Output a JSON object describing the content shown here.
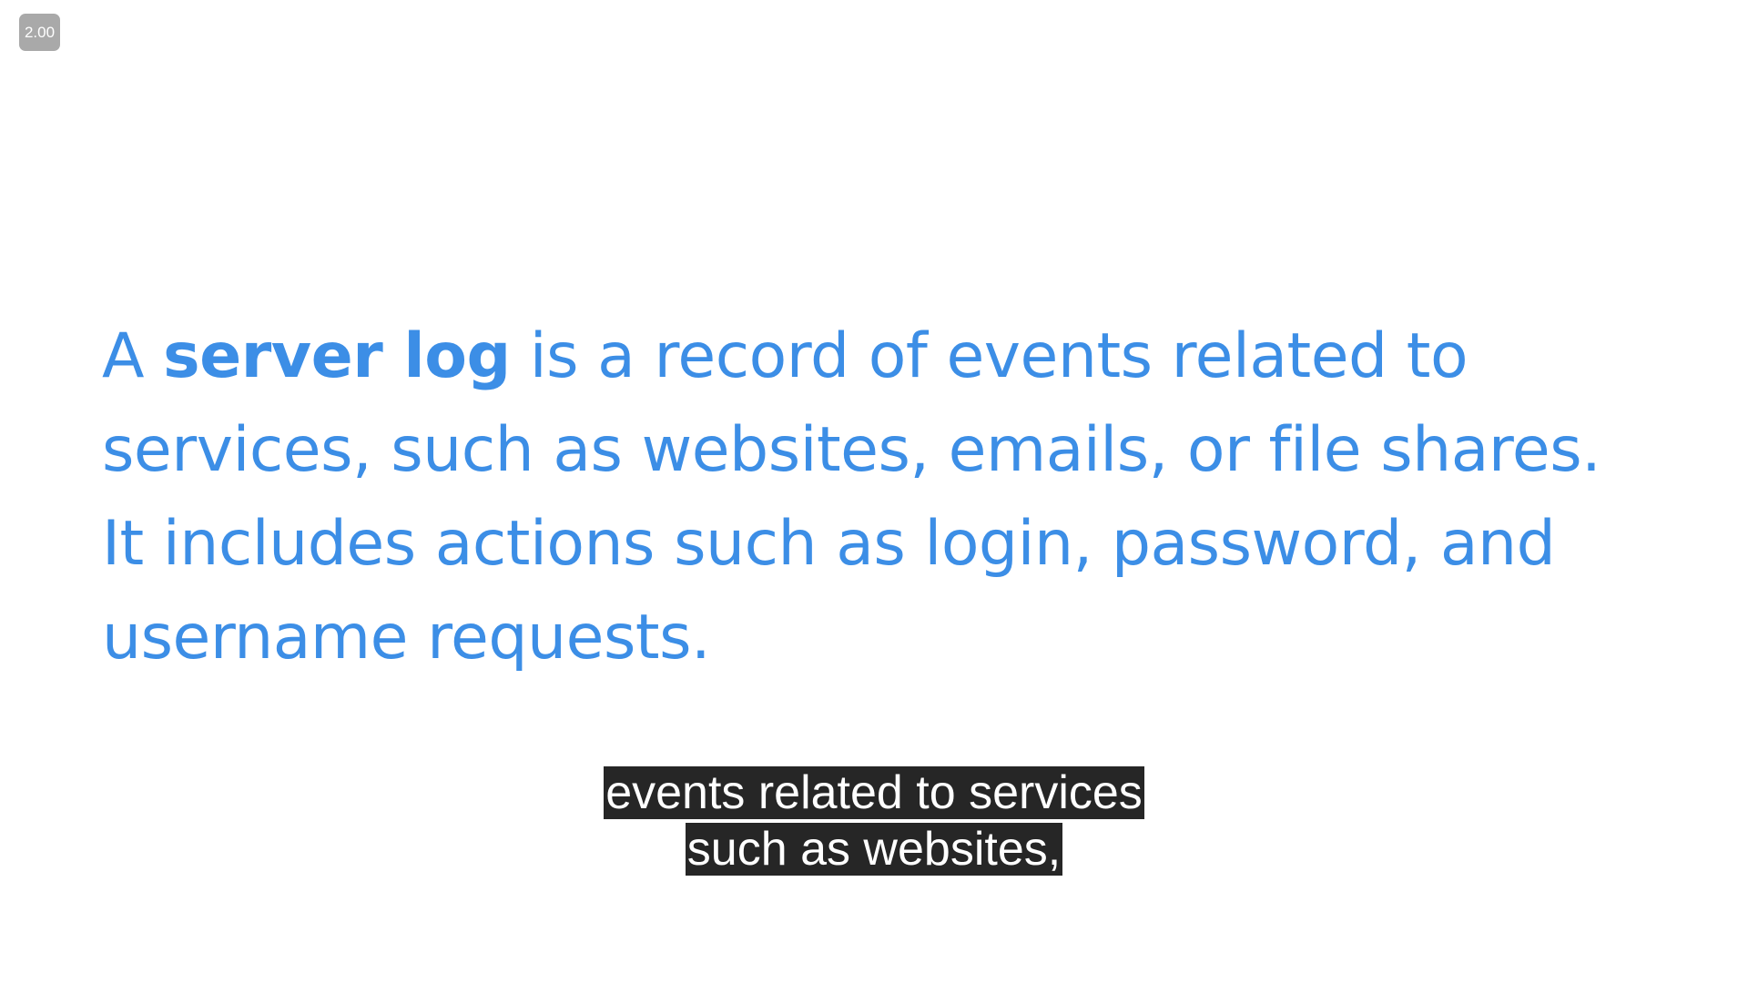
{
  "player": {
    "speed_badge": "2.00"
  },
  "slide": {
    "line1_pre": "A ",
    "line1_bold": "server log",
    "line1_post": " is a record of events related to",
    "line2": "services, such as websites, emails, or file shares.",
    "line3": "It includes actions such as login, password, and",
    "line4": "username requests.",
    "text_color": "#3c8ee6"
  },
  "captions": {
    "line1": "events related to services",
    "line2": "such as websites,"
  }
}
